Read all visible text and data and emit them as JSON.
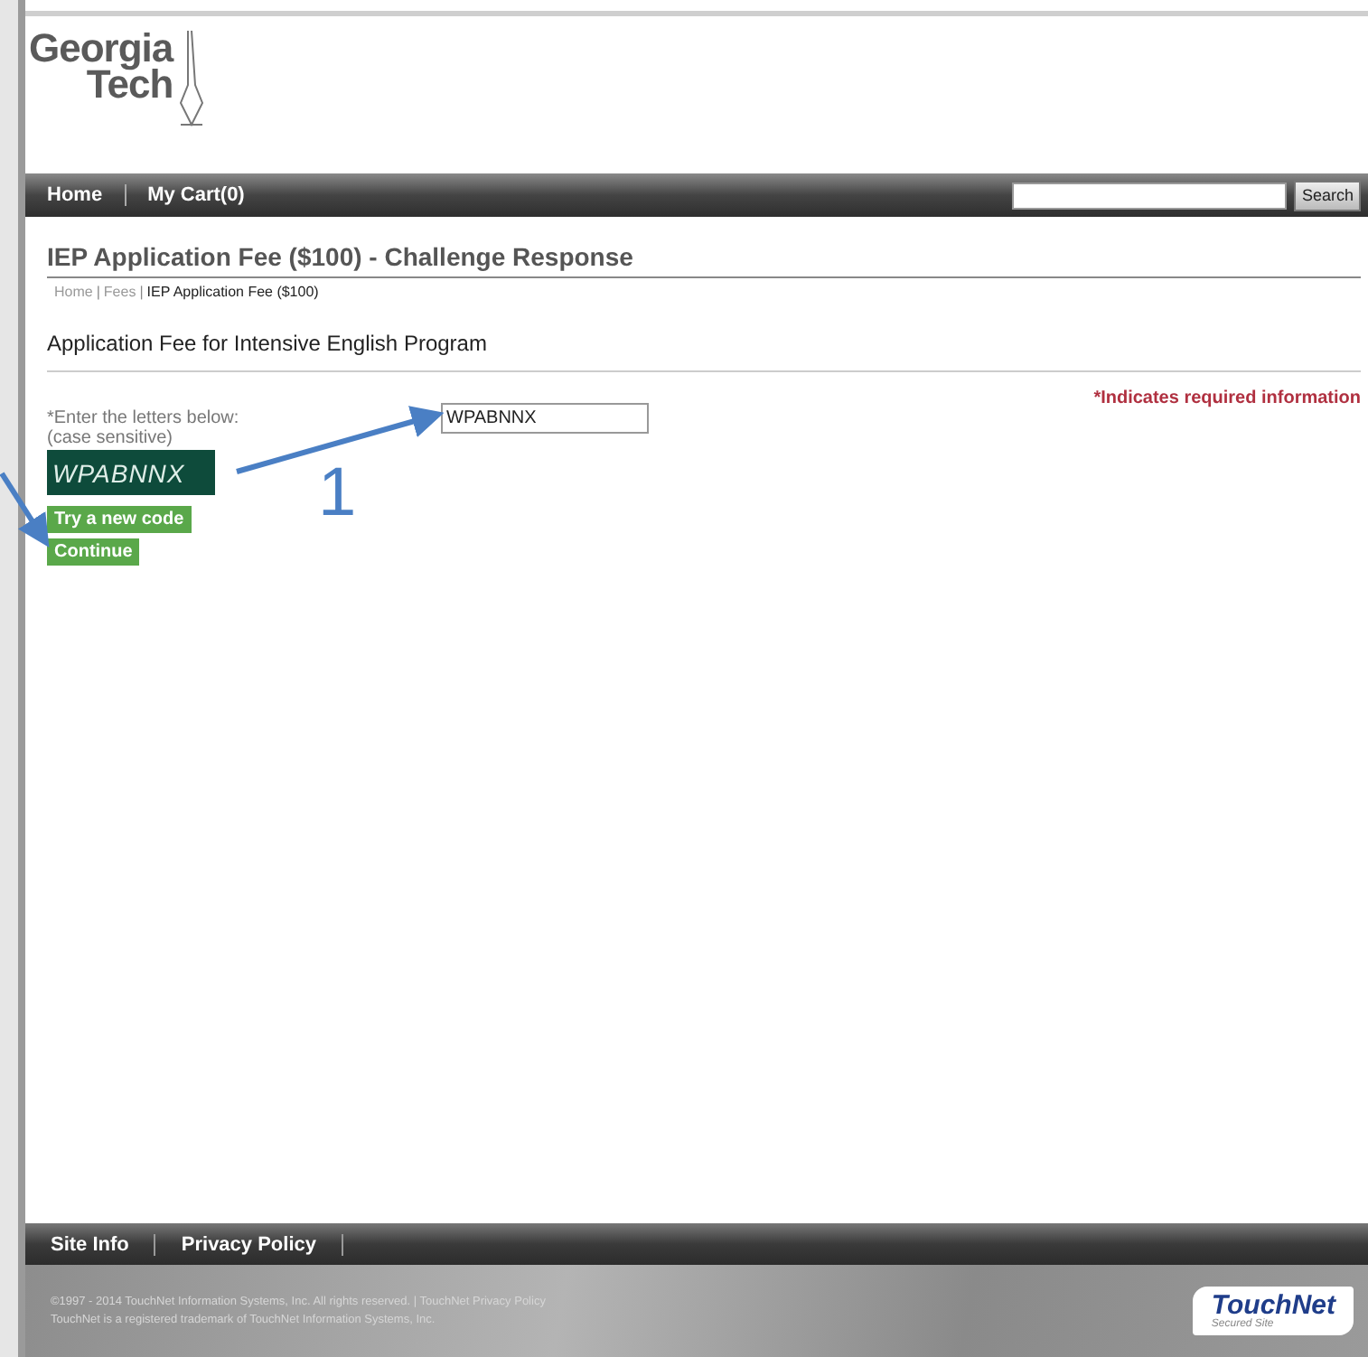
{
  "header": {
    "logo": {
      "line1": "Georgia",
      "line2": "Tech"
    }
  },
  "nav": {
    "items": [
      {
        "label": "Home"
      },
      {
        "label": "My Cart(0)"
      }
    ],
    "search": {
      "button": "Search"
    }
  },
  "page": {
    "title": "IEP Application Fee ($100) - Challenge Response",
    "breadcrumb": {
      "separator": "|",
      "items": [
        {
          "label": "Home",
          "link": true
        },
        {
          "label": "Fees",
          "link": true
        },
        {
          "label": "IEP Application Fee ($100)",
          "link": false
        }
      ]
    },
    "subtitle": "Application Fee for Intensive English Program",
    "required_note": "*Indicates required information",
    "captcha": {
      "label_lines": [
        "*Enter the letters below:",
        "(case sensitive)"
      ],
      "image_text": "WPABNNX",
      "value": "WPABNNX"
    },
    "buttons": [
      "Try a new code",
      "Continue"
    ]
  },
  "annotation": {
    "number": "1"
  },
  "footer": {
    "links": [
      "Site Info",
      "Privacy Policy"
    ],
    "lines": [
      "©1997 - 2014 TouchNet Information Systems, Inc. All rights reserved. | TouchNet Privacy Policy",
      "TouchNet is a registered trademark of TouchNet Information Systems, Inc."
    ],
    "badge": {
      "brand": "TouchNet",
      "tagline": "Secured Site"
    }
  }
}
